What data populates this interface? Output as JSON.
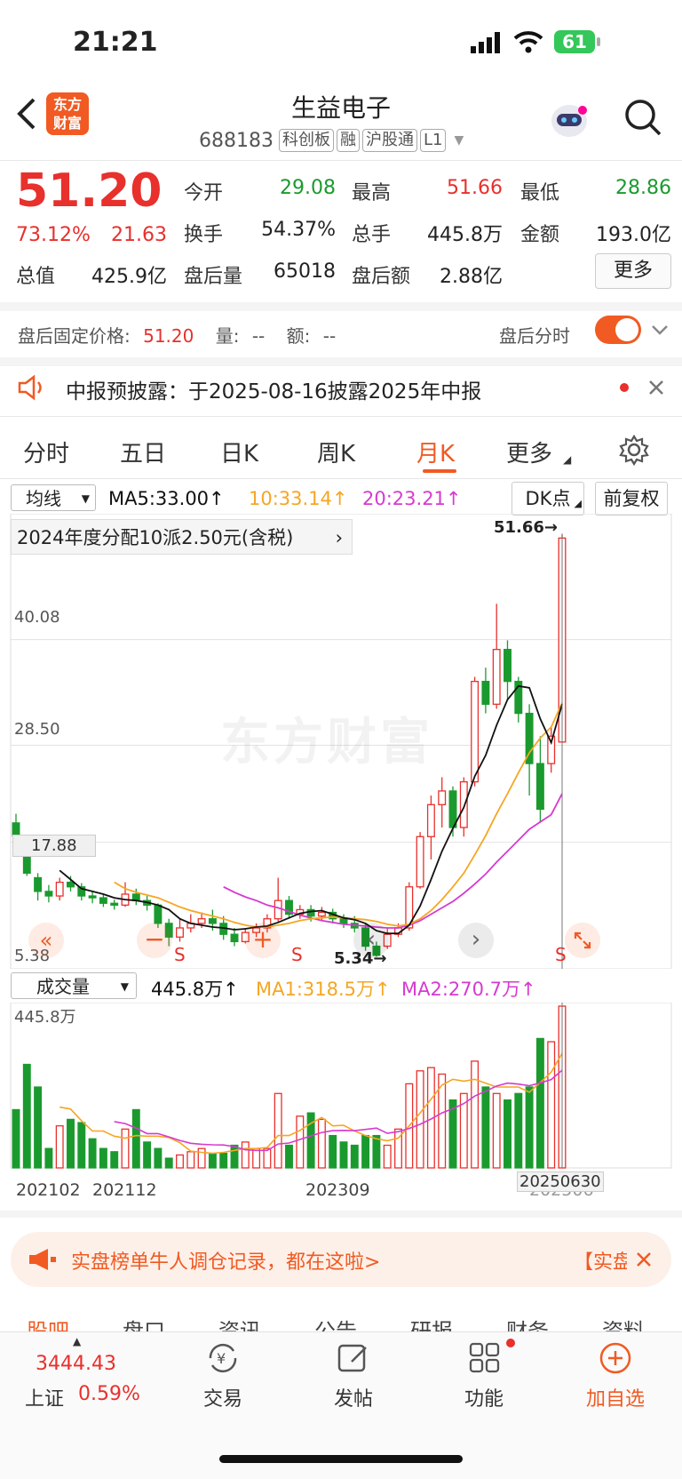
{
  "status_bar": {
    "time": "21:21",
    "battery": "61"
  },
  "header": {
    "logo_line1": "东方",
    "logo_line2": "财富",
    "title": "生益电子",
    "code": "688183",
    "tags": [
      "科创板",
      "融",
      "沪股通",
      "L1"
    ]
  },
  "quote": {
    "price": "51.20",
    "change_pct": "73.12%",
    "change": "21.63",
    "open_label": "今开",
    "open": "29.08",
    "high_label": "最高",
    "high": "51.66",
    "low_label": "最低",
    "low": "28.86",
    "turnover_label": "换手",
    "turnover": "54.37%",
    "volume_label": "总手",
    "volume": "445.8万",
    "amount_label": "金额",
    "amount": "193.0亿",
    "mcap_label": "总值",
    "mcap": "425.9亿",
    "ah_vol_label": "盘后量",
    "ah_vol": "65018",
    "ah_amt_label": "盘后额",
    "ah_amt": "2.88亿",
    "more": "更多"
  },
  "after_hours": {
    "label": "盘后固定价格:",
    "price": "51.20",
    "vol_label": "量:",
    "vol": "--",
    "amt_label": "额:",
    "amt": "--",
    "toggle_label": "盘后分时"
  },
  "notice": {
    "text": "中报预披露：于2025-08-16披露2025年中报"
  },
  "tabs": [
    "分时",
    "五日",
    "日K",
    "周K",
    "月K",
    "更多"
  ],
  "indicator": {
    "selector": "均线",
    "ma5": "MA5:33.00↑",
    "ma10": "10:33.14↑",
    "ma20": "20:23.21↑",
    "dk": "DK点",
    "fq": "前复权"
  },
  "dividend": "2024年度分配10派2.50元(含税)",
  "chart_labels": {
    "max": "51.66→",
    "min": "5.34→",
    "p1": "40.08",
    "p2": "28.50",
    "p3": "17.88",
    "p4": "5.38",
    "watermark": "东方财富"
  },
  "volume_panel": {
    "selector": "成交量",
    "value": "445.8万↑",
    "ma1": "MA1:318.5万↑",
    "ma2": "MA2:270.7万↑",
    "top_label": "445.8万"
  },
  "dates": {
    "d1": "202102",
    "d2": "202112",
    "d3": "202309",
    "d4": "202506",
    "cursor": "20250630"
  },
  "banner": "实盘榜单牛人调仓记录，都在这啦>",
  "banner_tag": "【实盘",
  "bottom_tabs": [
    "股吧",
    "盘口",
    "资讯",
    "公告",
    "研报",
    "财务",
    "资料"
  ],
  "index": {
    "value": "3444.43",
    "name": "上证",
    "pct": "0.59%"
  },
  "nav": [
    "交易",
    "发帖",
    "功能",
    "加自选"
  ],
  "chart_data": {
    "type": "candlestick",
    "price_ticks": [
      51.66,
      40.08,
      28.5,
      17.88,
      5.38
    ],
    "candles": [
      {
        "o": 20.0,
        "c": 18.6,
        "h": 21.0,
        "l": 18.0
      },
      {
        "o": 16.5,
        "c": 14.5,
        "h": 17.5,
        "l": 14.2
      },
      {
        "o": 14.0,
        "c": 12.5,
        "h": 14.5,
        "l": 11.5
      },
      {
        "o": 12.5,
        "c": 12.0,
        "h": 13.2,
        "l": 11.3
      },
      {
        "o": 12.0,
        "c": 13.5,
        "h": 14.0,
        "l": 11.5
      },
      {
        "o": 13.5,
        "c": 13.0,
        "h": 14.2,
        "l": 12.5
      },
      {
        "o": 13.0,
        "c": 12.0,
        "h": 13.4,
        "l": 11.5
      },
      {
        "o": 12.0,
        "c": 11.8,
        "h": 12.5,
        "l": 11.2
      },
      {
        "o": 11.8,
        "c": 11.2,
        "h": 12.2,
        "l": 10.8
      },
      {
        "o": 11.2,
        "c": 11.0,
        "h": 11.6,
        "l": 10.5
      },
      {
        "o": 11.0,
        "c": 12.2,
        "h": 13.5,
        "l": 10.8
      },
      {
        "o": 12.2,
        "c": 11.5,
        "h": 12.8,
        "l": 11.0
      },
      {
        "o": 11.5,
        "c": 11.0,
        "h": 12.0,
        "l": 10.4
      },
      {
        "o": 11.0,
        "c": 9.0,
        "h": 11.2,
        "l": 8.5
      },
      {
        "o": 9.0,
        "c": 7.5,
        "h": 9.5,
        "l": 6.5
      },
      {
        "o": 7.5,
        "c": 8.5,
        "h": 9.5,
        "l": 7.0
      },
      {
        "o": 8.5,
        "c": 9.0,
        "h": 10.0,
        "l": 8.0
      },
      {
        "o": 9.0,
        "c": 9.5,
        "h": 10.2,
        "l": 8.5
      },
      {
        "o": 9.5,
        "c": 9.0,
        "h": 10.5,
        "l": 8.2
      },
      {
        "o": 9.0,
        "c": 7.8,
        "h": 9.8,
        "l": 7.2
      },
      {
        "o": 7.8,
        "c": 7.0,
        "h": 8.5,
        "l": 6.5
      },
      {
        "o": 7.0,
        "c": 8.0,
        "h": 8.5,
        "l": 6.8
      },
      {
        "o": 8.0,
        "c": 8.5,
        "h": 9.0,
        "l": 7.5
      },
      {
        "o": 8.5,
        "c": 9.5,
        "h": 10.0,
        "l": 8.0
      },
      {
        "o": 9.5,
        "c": 11.5,
        "h": 14.0,
        "l": 9.2
      },
      {
        "o": 11.5,
        "c": 10.0,
        "h": 12.0,
        "l": 9.5
      },
      {
        "o": 10.0,
        "c": 10.5,
        "h": 11.0,
        "l": 9.5
      },
      {
        "o": 10.5,
        "c": 9.8,
        "h": 11.0,
        "l": 9.2
      },
      {
        "o": 9.8,
        "c": 10.2,
        "h": 10.8,
        "l": 9.3
      },
      {
        "o": 10.2,
        "c": 9.5,
        "h": 10.6,
        "l": 9.0
      },
      {
        "o": 9.5,
        "c": 9.0,
        "h": 10.0,
        "l": 8.5
      },
      {
        "o": 9.0,
        "c": 8.5,
        "h": 9.8,
        "l": 8.0
      },
      {
        "o": 8.5,
        "c": 6.5,
        "h": 9.0,
        "l": 6.0
      },
      {
        "o": 6.5,
        "c": 5.5,
        "h": 7.0,
        "l": 5.34
      },
      {
        "o": 6.5,
        "c": 7.8,
        "h": 8.5,
        "l": 6.2
      },
      {
        "o": 7.8,
        "c": 8.5,
        "h": 9.0,
        "l": 7.5
      },
      {
        "o": 8.5,
        "c": 13.0,
        "h": 13.5,
        "l": 8.2
      },
      {
        "o": 13.0,
        "c": 18.5,
        "h": 19.0,
        "l": 12.8
      },
      {
        "o": 18.5,
        "c": 22.0,
        "h": 23.0,
        "l": 16.0
      },
      {
        "o": 22.0,
        "c": 23.5,
        "h": 25.0,
        "l": 19.5
      },
      {
        "o": 23.5,
        "c": 19.5,
        "h": 24.0,
        "l": 18.5
      },
      {
        "o": 19.5,
        "c": 24.5,
        "h": 25.0,
        "l": 18.5
      },
      {
        "o": 24.5,
        "c": 35.5,
        "h": 36.0,
        "l": 24.0
      },
      {
        "o": 35.5,
        "c": 33.0,
        "h": 37.0,
        "l": 32.0
      },
      {
        "o": 33.0,
        "c": 39.0,
        "h": 44.0,
        "l": 32.5
      },
      {
        "o": 39.0,
        "c": 35.5,
        "h": 40.0,
        "l": 33.5
      },
      {
        "o": 35.5,
        "c": 32.0,
        "h": 36.0,
        "l": 31.0
      },
      {
        "o": 32.0,
        "c": 26.5,
        "h": 33.0,
        "l": 23.0
      },
      {
        "o": 26.5,
        "c": 21.5,
        "h": 29.5,
        "l": 20.0
      },
      {
        "o": 26.5,
        "c": 29.5,
        "h": 30.5,
        "l": 25.5
      },
      {
        "o": 28.86,
        "c": 51.2,
        "h": 51.66,
        "l": 28.86
      }
    ],
    "volumes": [
      180,
      320,
      250,
      60,
      130,
      150,
      140,
      90,
      60,
      50,
      120,
      180,
      80,
      60,
      30,
      40,
      50,
      60,
      45,
      45,
      70,
      80,
      60,
      60,
      230,
      70,
      160,
      170,
      150,
      100,
      80,
      70,
      100,
      100,
      70,
      120,
      260,
      300,
      310,
      290,
      210,
      230,
      330,
      250,
      230,
      210,
      230,
      250,
      400,
      390,
      500
    ],
    "ma5": [
      null,
      null,
      null,
      null,
      14.8,
      13.8,
      12.8,
      12.5,
      12.2,
      11.8,
      11.6,
      11.5,
      11.3,
      11.0,
      10.5,
      9.5,
      9.0,
      8.8,
      8.6,
      8.5,
      8.3,
      8.4,
      8.6,
      8.7,
      9.1,
      9.6,
      10.1,
      10.3,
      10.4,
      10.0,
      9.6,
      9.4,
      9.0,
      8.2,
      7.9,
      7.9,
      8.8,
      10.9,
      13.8,
      16.9,
      19.4,
      21.7,
      25.1,
      27.4,
      30.7,
      33.5,
      35.0,
      34.8,
      31.4,
      28.8,
      33.0
    ],
    "ma10": [
      null,
      null,
      null,
      null,
      null,
      null,
      null,
      null,
      null,
      13.5,
      12.8,
      12.4,
      12.1,
      11.8,
      11.3,
      10.8,
      10.4,
      10.1,
      9.8,
      9.5,
      9.1,
      8.8,
      8.6,
      8.6,
      8.8,
      9.0,
      9.3,
      9.5,
      9.6,
      9.7,
      9.6,
      9.5,
      9.4,
      9.2,
      8.9,
      8.7,
      8.9,
      9.5,
      10.4,
      11.6,
      13.0,
      14.5,
      16.5,
      18.6,
      21.0,
      23.2,
      25.5,
      27.7,
      29.3,
      30.5,
      33.14
    ],
    "ma20": [
      null,
      null,
      null,
      null,
      null,
      null,
      null,
      null,
      null,
      null,
      null,
      null,
      null,
      null,
      null,
      null,
      null,
      null,
      null,
      13.0,
      12.4,
      11.9,
      11.5,
      11.0,
      10.7,
      10.3,
      9.9,
      9.6,
      9.3,
      9.1,
      8.9,
      8.8,
      8.7,
      8.6,
      8.5,
      8.5,
      8.8,
      9.3,
      10.0,
      10.7,
      11.4,
      12.3,
      13.3,
      14.4,
      15.7,
      16.9,
      18.1,
      19.3,
      20.1,
      20.9,
      23.21
    ]
  }
}
